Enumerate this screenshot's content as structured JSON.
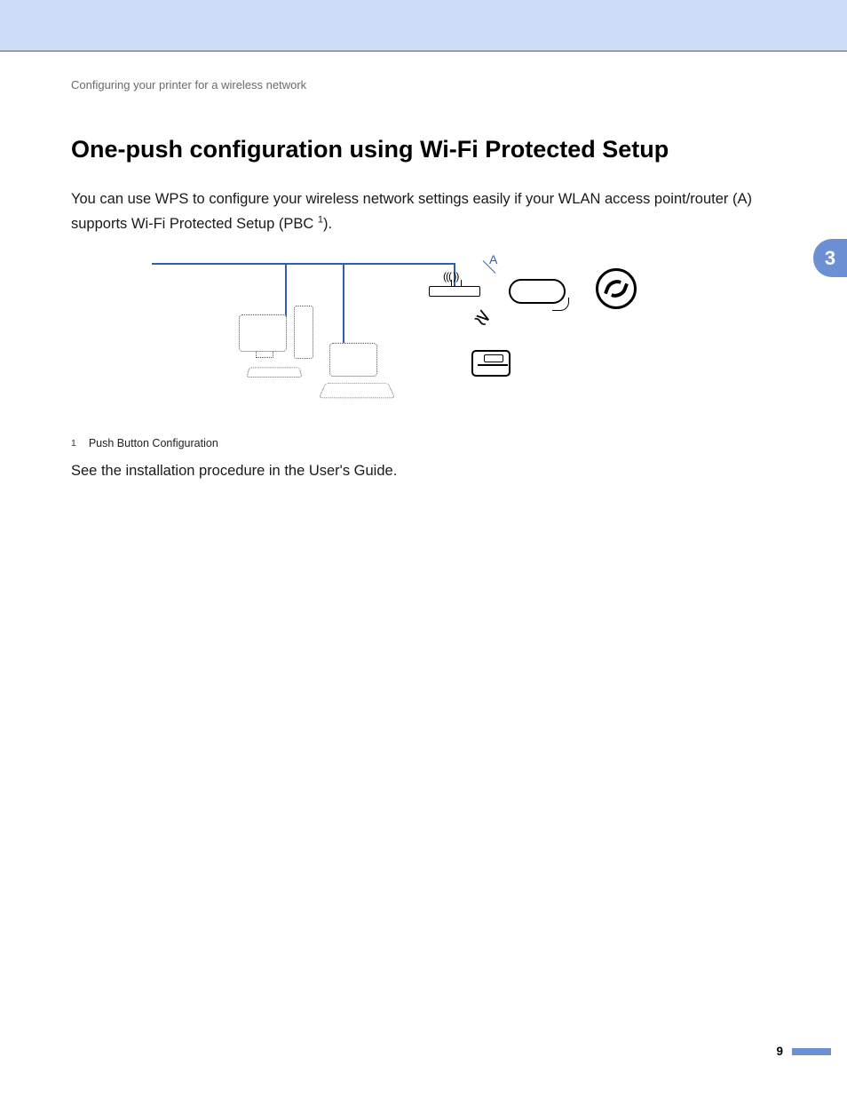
{
  "breadcrumb": "Configuring your printer for a wireless network",
  "heading": "One-push configuration using Wi-Fi Protected Setup",
  "paragraph1_pre": "You can use WPS to configure your wireless network settings easily if your WLAN access point/router (A) supports Wi-Fi Protected Setup (PBC",
  "paragraph1_sup": "1",
  "paragraph1_post": ").",
  "diagram": {
    "label_a": "A",
    "wifi_waves": "((( ))"
  },
  "footnote": {
    "marker": "1",
    "text": "Push Button Configuration"
  },
  "paragraph2": "See the installation procedure in the User's Guide.",
  "chapter_tab": "3",
  "page_number": "9"
}
